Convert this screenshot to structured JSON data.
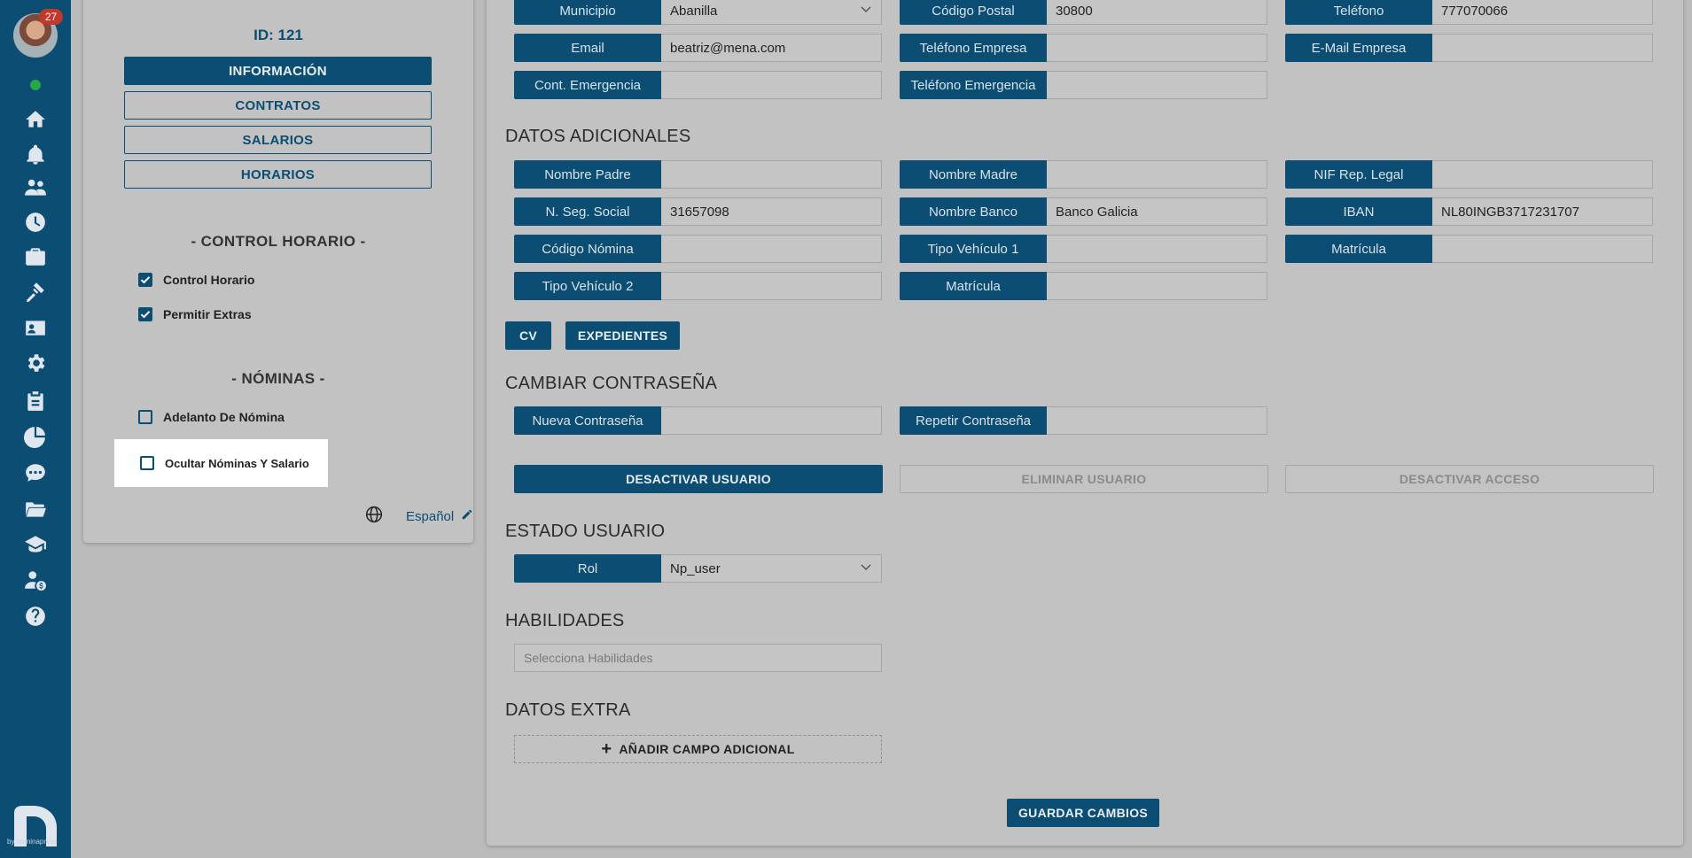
{
  "sidebar": {
    "notification_count": "27",
    "brand_text": "by nominapress",
    "icons": [
      "home-icon",
      "bell-icon",
      "users-icon",
      "clock-icon",
      "briefcase-icon",
      "tools-icon",
      "id-card-icon",
      "gear-icon",
      "clipboard-icon",
      "pie-chart-icon",
      "chat-icon",
      "folder-icon",
      "graduation-cap-icon",
      "user-money-icon",
      "help-icon"
    ]
  },
  "left_panel": {
    "id_label": "ID: 121",
    "buttons": [
      "INFORMACIÓN",
      "CONTRATOS",
      "SALARIOS",
      "HORARIOS"
    ],
    "control_horario": {
      "title": "- CONTROL HORARIO -",
      "items": [
        {
          "label": "Control Horario",
          "checked": true
        },
        {
          "label": "Permitir Extras",
          "checked": true
        }
      ]
    },
    "nominas": {
      "title": "- NÓMINAS -",
      "items": [
        {
          "label": "Adelanto De Nómina",
          "checked": false
        },
        {
          "label": "Ocultar Nóminas Y Salario",
          "checked": false
        }
      ]
    },
    "language": "Español"
  },
  "contact": {
    "municipio": {
      "label": "Municipio",
      "value": "Abanilla"
    },
    "codigo_postal": {
      "label": "Código Postal",
      "value": "30800"
    },
    "telefono": {
      "label": "Teléfono",
      "value": "777070066"
    },
    "email": {
      "label": "Email",
      "value": "beatriz@mena.com"
    },
    "telefono_empresa": {
      "label": "Teléfono Empresa",
      "value": ""
    },
    "email_empresa": {
      "label": "E-Mail Empresa",
      "value": ""
    },
    "cont_emergencia": {
      "label": "Cont. Emergencia",
      "value": ""
    },
    "telefono_emergencia": {
      "label": "Teléfono Emergencia",
      "value": ""
    }
  },
  "datos_adicionales": {
    "title": "DATOS ADICIONALES",
    "nombre_padre": {
      "label": "Nombre Padre",
      "value": ""
    },
    "nombre_madre": {
      "label": "Nombre Madre",
      "value": ""
    },
    "nif_rep_legal": {
      "label": "NIF Rep. Legal",
      "value": ""
    },
    "n_seg_social": {
      "label": "N. Seg. Social",
      "value": "31657098"
    },
    "nombre_banco": {
      "label": "Nombre Banco",
      "value": "Banco Galicia"
    },
    "iban": {
      "label": "IBAN",
      "value": "NL80INGB3717231707"
    },
    "codigo_nomina": {
      "label": "Código Nómina",
      "value": ""
    },
    "tipo_vehiculo_1": {
      "label": "Tipo Vehículo 1",
      "value": ""
    },
    "matricula_1": {
      "label": "Matrícula",
      "value": ""
    },
    "tipo_vehiculo_2": {
      "label": "Tipo Vehículo 2",
      "value": ""
    },
    "matricula_2": {
      "label": "Matrícula",
      "value": ""
    },
    "cv_button": "CV",
    "expedientes_button": "EXPEDIENTES"
  },
  "password": {
    "title": "CAMBIAR CONTRASEÑA",
    "nueva": {
      "label": "Nueva Contraseña",
      "value": ""
    },
    "repetir": {
      "label": "Repetir Contraseña",
      "value": ""
    }
  },
  "user_actions": {
    "desactivar_usuario": "DESACTIVAR USUARIO",
    "eliminar_usuario": "ELIMINAR USUARIO",
    "desactivar_acceso": "DESACTIVAR ACCESO"
  },
  "estado_usuario": {
    "title": "ESTADO USUARIO",
    "rol": {
      "label": "Rol",
      "value": "Np_user"
    }
  },
  "habilidades": {
    "title": "HABILIDADES",
    "placeholder": "Selecciona Habilidades"
  },
  "datos_extra": {
    "title": "DATOS EXTRA",
    "add_button": "AÑADIR CAMPO ADICIONAL"
  },
  "save_button": "GUARDAR CAMBIOS",
  "colors": {
    "primary": "#0c4d73",
    "badge": "#c0392b",
    "status_online": "#28a745"
  }
}
